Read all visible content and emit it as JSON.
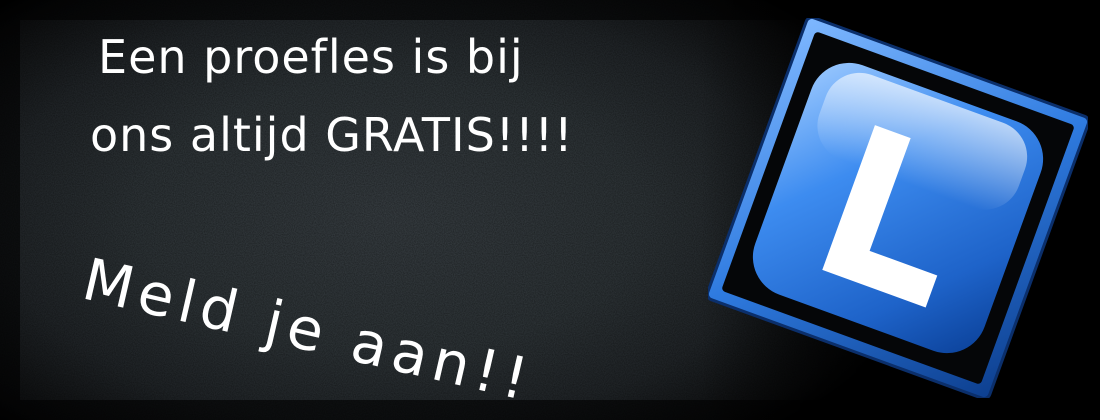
{
  "banner": {
    "line1": "Een proefles is bij",
    "line2": "ons altijd GRATIS!!!!",
    "line3": "Meld je aan!!"
  },
  "logo": {
    "letter": "L",
    "icon": "learner-l-cube-icon",
    "color": "#2f7be0"
  },
  "colors": {
    "board": "#2b3134",
    "text": "#ffffff",
    "logo_blue": "#2f7be0"
  }
}
